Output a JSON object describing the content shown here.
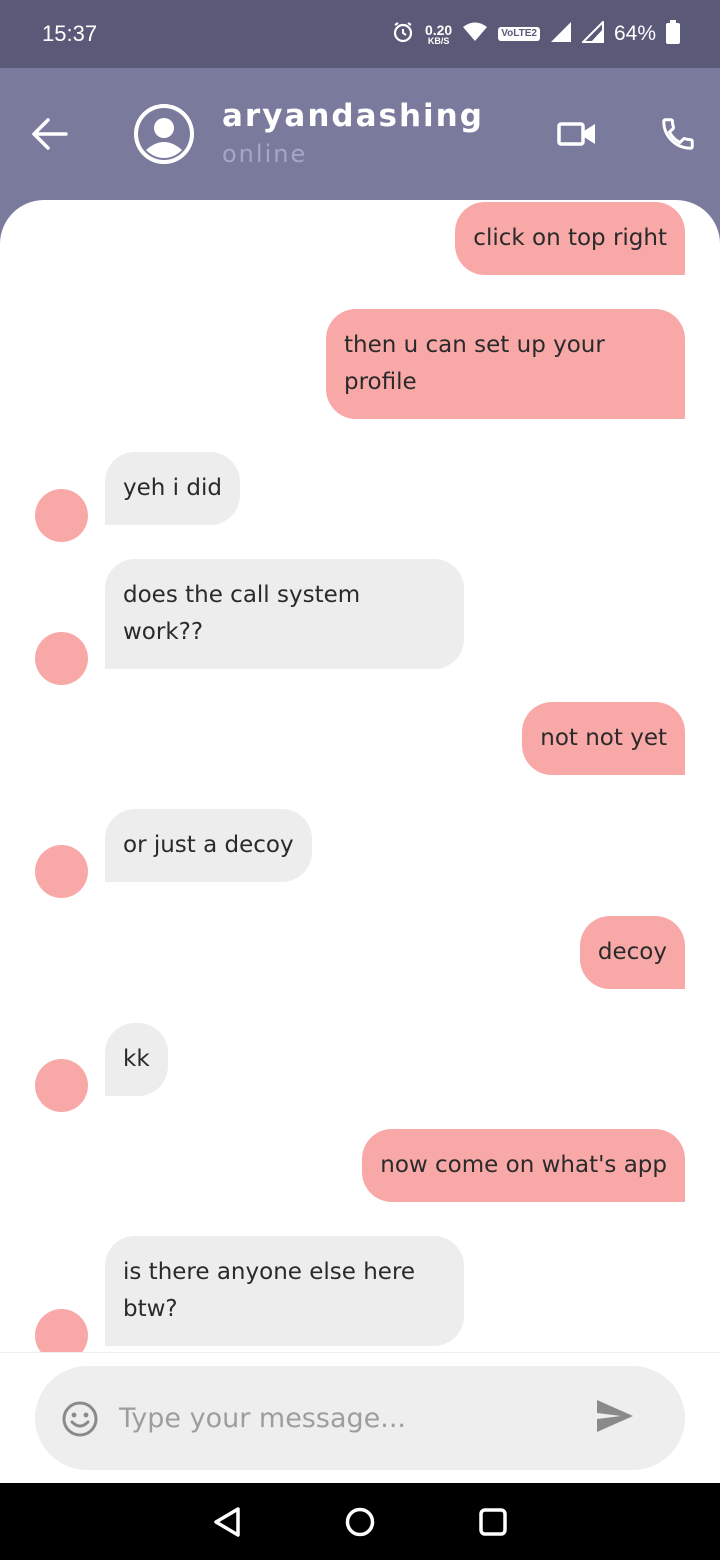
{
  "status_bar": {
    "time": "15:37",
    "net_speed_value": "0.20",
    "net_speed_unit": "KB/S",
    "volte_label": "VoLTE2",
    "battery_percent": "64%",
    "icons": [
      "alarm-icon",
      "wifi-icon",
      "signal-icon",
      "signal-roaming-icon",
      "battery-icon"
    ]
  },
  "header": {
    "contact_name": "aryandashing",
    "contact_status": "online",
    "icons": [
      "back-arrow-icon",
      "avatar-icon",
      "video-call-icon",
      "phone-icon"
    ]
  },
  "messages": [
    {
      "direction": "out",
      "text": "click on top right"
    },
    {
      "direction": "out",
      "text": "then u can set up your profile"
    },
    {
      "direction": "in",
      "text": "yeh i did"
    },
    {
      "direction": "in",
      "text": "does the call system work??"
    },
    {
      "direction": "out",
      "text": "not not yet"
    },
    {
      "direction": "in",
      "text": "or just a decoy"
    },
    {
      "direction": "out",
      "text": "decoy"
    },
    {
      "direction": "in",
      "text": "kk"
    },
    {
      "direction": "out",
      "text": "now come on what's app"
    },
    {
      "direction": "in",
      "text": "is there anyone else here btw?"
    }
  ],
  "input": {
    "placeholder": "Type your message...",
    "value": "",
    "icons": [
      "emoji-icon",
      "send-icon"
    ]
  },
  "nav_bar": {
    "icons": [
      "back-triangle-icon",
      "home-circle-icon",
      "recents-square-icon"
    ]
  },
  "colors": {
    "header_bg": "#7a7a9d",
    "status_bar_bg": "#5a5a78",
    "outgoing_bubble": "#f9a8a8",
    "incoming_bubble": "#ededed",
    "secondary_text": "#a7a7c3"
  }
}
